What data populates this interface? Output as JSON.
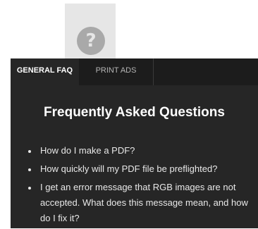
{
  "help": {
    "icon_glyph": "?",
    "icon": "question-mark-circle"
  },
  "tabs": [
    {
      "label": "GENERAL FAQ",
      "active": true
    },
    {
      "label": "PRINT ADS",
      "active": false
    }
  ],
  "content": {
    "title": "Frequently Asked Questions",
    "questions": [
      "How do I make a PDF?",
      "How quickly will my PDF file be preflighted?",
      "I get an error message that RGB images are not accepted. What does this message mean, and how do I fix it?"
    ]
  },
  "colors": {
    "panel_bg": "#262626",
    "tabbar_bg": "#1c1c1c",
    "tile_bg": "#e6e6e6",
    "icon_bg": "#a9a9a9"
  }
}
